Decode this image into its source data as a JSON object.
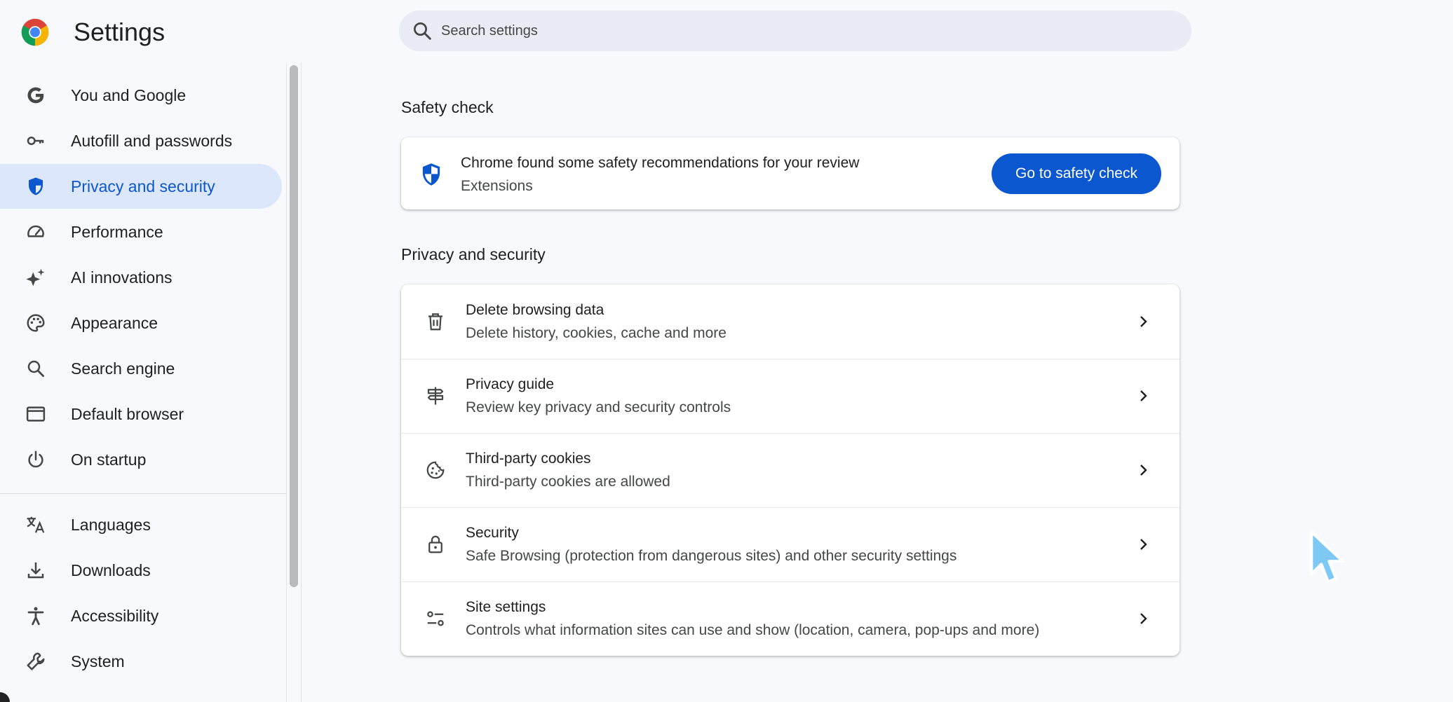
{
  "header": {
    "title": "Settings",
    "search_placeholder": "Search settings"
  },
  "sidebar": {
    "items": [
      {
        "label": "You and Google",
        "icon": "google-g-icon"
      },
      {
        "label": "Autofill and passwords",
        "icon": "key-icon"
      },
      {
        "label": "Privacy and security",
        "icon": "shield-icon",
        "active": true
      },
      {
        "label": "Performance",
        "icon": "speedometer-icon"
      },
      {
        "label": "AI innovations",
        "icon": "sparkle-icon"
      },
      {
        "label": "Appearance",
        "icon": "palette-icon"
      },
      {
        "label": "Search engine",
        "icon": "search-icon"
      },
      {
        "label": "Default browser",
        "icon": "browser-window-icon"
      },
      {
        "label": "On startup",
        "icon": "power-icon"
      },
      {
        "label": "Languages",
        "icon": "translate-icon"
      },
      {
        "label": "Downloads",
        "icon": "download-icon"
      },
      {
        "label": "Accessibility",
        "icon": "accessibility-icon"
      },
      {
        "label": "System",
        "icon": "wrench-icon"
      }
    ]
  },
  "safety_check": {
    "section_title": "Safety check",
    "message": "Chrome found some safety recommendations for your review",
    "sub": "Extensions",
    "button_label": "Go to safety check"
  },
  "privacy": {
    "section_title": "Privacy and security",
    "rows": [
      {
        "title": "Delete browsing data",
        "sub": "Delete history, cookies, cache and more",
        "icon": "trash-icon"
      },
      {
        "title": "Privacy guide",
        "sub": "Review key privacy and security controls",
        "icon": "signpost-icon"
      },
      {
        "title": "Third-party cookies",
        "sub": "Third-party cookies are allowed",
        "icon": "cookie-icon"
      },
      {
        "title": "Security",
        "sub": "Safe Browsing (protection from dangerous sites) and other security settings",
        "icon": "lock-icon"
      },
      {
        "title": "Site settings",
        "sub": "Controls what information sites can use and show (location, camera, pop-ups and more)",
        "icon": "tune-icon"
      }
    ]
  },
  "colors": {
    "accent": "#0b57d0",
    "active_bg": "#dde7fb",
    "background": "#f8f9fc"
  }
}
